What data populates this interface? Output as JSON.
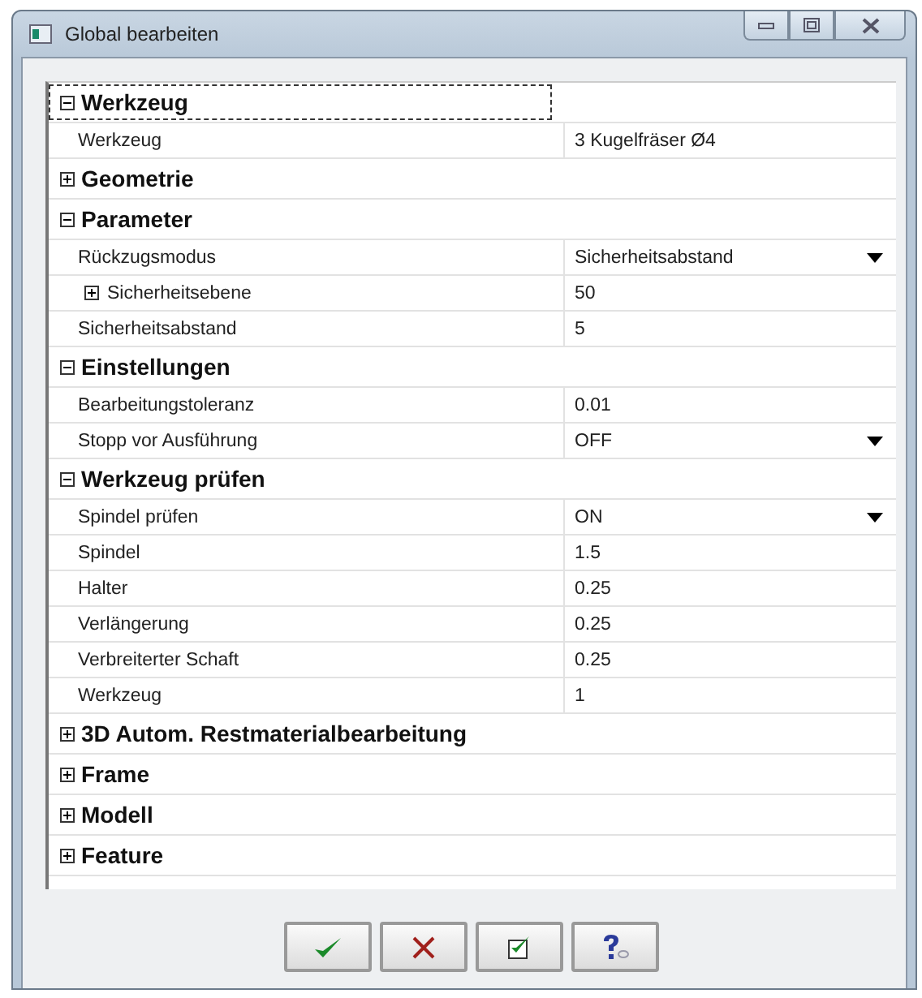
{
  "window": {
    "title": "Global bearbeiten"
  },
  "groups": [
    {
      "title": "Werkzeug",
      "expanded": true,
      "selected": true,
      "rows": [
        {
          "name": "Werkzeug",
          "value": "3  Kugelfräser  Ø4",
          "kind": "text"
        }
      ]
    },
    {
      "title": "Geometrie",
      "expanded": false,
      "selected": false
    },
    {
      "title": "Parameter",
      "expanded": true,
      "selected": false,
      "rows": [
        {
          "name": "Rückzugsmodus",
          "value": "Sicherheitsabstand",
          "kind": "dropdown"
        },
        {
          "name": "Sicherheitsebene",
          "value": "50",
          "kind": "subgroup",
          "expanded": false
        },
        {
          "name": "Sicherheitsabstand",
          "value": "5",
          "kind": "text"
        }
      ]
    },
    {
      "title": "Einstellungen",
      "expanded": true,
      "selected": false,
      "rows": [
        {
          "name": "Bearbeitungstoleranz",
          "value": "0.01",
          "kind": "text"
        },
        {
          "name": "Stopp vor Ausführung",
          "value": "OFF",
          "kind": "dropdown"
        }
      ]
    },
    {
      "title": "Werkzeug prüfen",
      "expanded": true,
      "selected": false,
      "rows": [
        {
          "name": "Spindel prüfen",
          "value": "ON",
          "kind": "dropdown"
        },
        {
          "name": "Spindel",
          "value": "1.5",
          "kind": "text"
        },
        {
          "name": "Halter",
          "value": "0.25",
          "kind": "text"
        },
        {
          "name": "Verlängerung",
          "value": "0.25",
          "kind": "text"
        },
        {
          "name": "Verbreiterter Schaft",
          "value": "0.25",
          "kind": "text"
        },
        {
          "name": "Werkzeug",
          "value": "1",
          "kind": "text"
        }
      ]
    },
    {
      "title": "3D Autom. Restmaterialbearbeitung",
      "expanded": false,
      "selected": false
    },
    {
      "title": "Frame",
      "expanded": false,
      "selected": false
    },
    {
      "title": "Modell",
      "expanded": false,
      "selected": false
    },
    {
      "title": "Feature",
      "expanded": false,
      "selected": false
    }
  ],
  "buttons": [
    {
      "kind": "ok"
    },
    {
      "kind": "cancel"
    },
    {
      "kind": "apply"
    },
    {
      "kind": "help"
    }
  ]
}
